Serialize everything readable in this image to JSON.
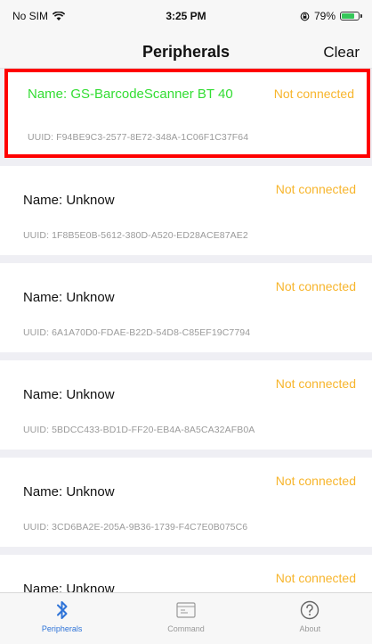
{
  "status_bar": {
    "carrier": "No SIM",
    "time": "3:25 PM",
    "battery": "79%",
    "battery_level": 0.79
  },
  "nav": {
    "title": "Peripherals",
    "clear_label": "Clear"
  },
  "peripherals": [
    {
      "name": "Name: GS-BarcodeScanner BT 40",
      "status": "Not connected",
      "uuid": "UUID: F94BE9C3-2577-8E72-348A-1C06F1C37F64",
      "selected": true
    },
    {
      "name": "Name: Unknow",
      "status": "Not connected",
      "uuid": "UUID: 1F8B5E0B-5612-380D-A520-ED28ACE87AE2"
    },
    {
      "name": "Name: Unknow",
      "status": "Not connected",
      "uuid": "UUID: 6A1A70D0-FDAE-B22D-54D8-C85EF19C7794"
    },
    {
      "name": "Name: Unknow",
      "status": "Not connected",
      "uuid": "UUID: 5BDCC433-BD1D-FF20-EB4A-8A5CA32AFB0A"
    },
    {
      "name": "Name: Unknow",
      "status": "Not connected",
      "uuid": "UUID: 3CD6BA2E-205A-9B36-1739-F4C7E0B075C6"
    },
    {
      "name": "Name: Unknow",
      "status": "Not connected",
      "uuid": ""
    }
  ],
  "tabs": [
    {
      "label": "Peripherals",
      "icon": "bluetooth-icon",
      "active": true
    },
    {
      "label": "Command",
      "icon": "command-icon",
      "active": false
    },
    {
      "label": "About",
      "icon": "question-icon",
      "active": false
    }
  ],
  "colors": {
    "connected_status": "#f7b52c",
    "selected_name": "#33dd33",
    "selection_border": "#ff0000",
    "tab_active": "#2f74d8"
  }
}
